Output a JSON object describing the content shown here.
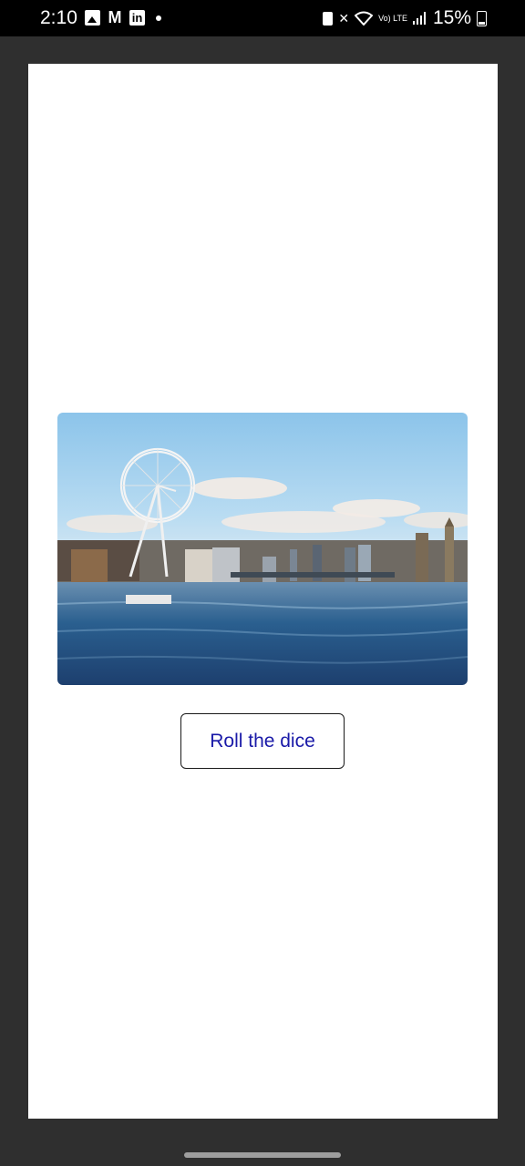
{
  "status_bar": {
    "time": "2:10",
    "left_icons": [
      "gallery-icon",
      "gmail-icon",
      "linkedin-icon",
      "notification-dot-icon"
    ],
    "right_icons": [
      "sim-icon",
      "mute-icon",
      "wifi-icon",
      "volte-lte-icon",
      "signal-icon",
      "battery-icon"
    ],
    "lte_label": "Vo) LTE",
    "battery_percent": "15%"
  },
  "main": {
    "image_icon": "london-eye-thames-photo",
    "button_label": "Roll the dice"
  },
  "colors": {
    "background": "#2f2f2f",
    "surface": "#ffffff",
    "button_text": "#1a1aa8"
  }
}
